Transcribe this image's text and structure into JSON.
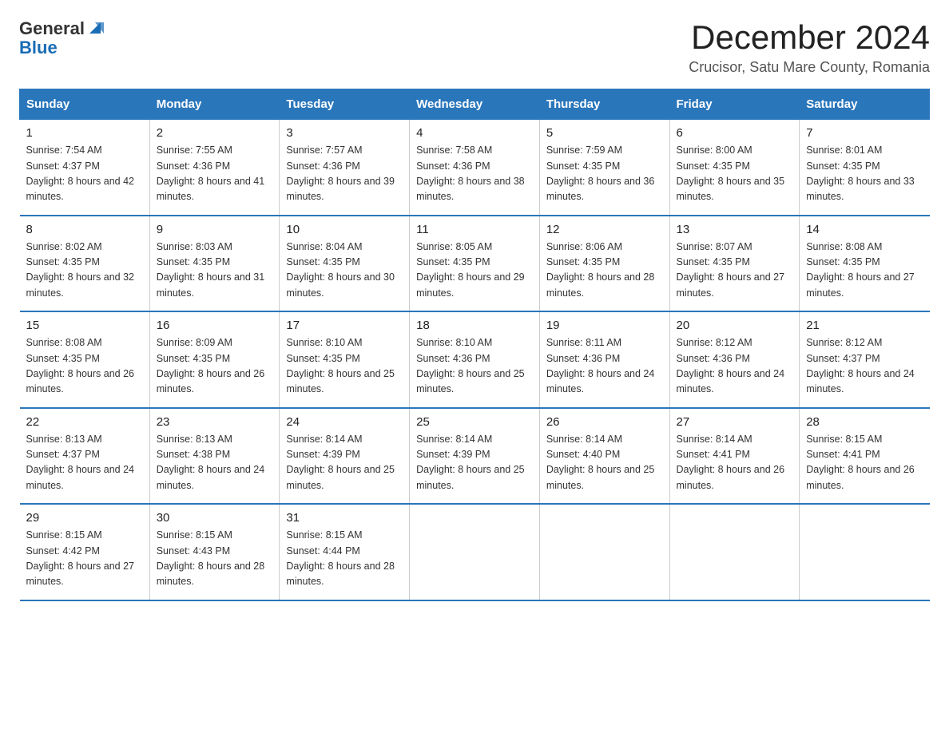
{
  "logo": {
    "general": "General",
    "blue": "Blue"
  },
  "title": "December 2024",
  "subtitle": "Crucisor, Satu Mare County, Romania",
  "headers": [
    "Sunday",
    "Monday",
    "Tuesday",
    "Wednesday",
    "Thursday",
    "Friday",
    "Saturday"
  ],
  "weeks": [
    [
      {
        "day": "1",
        "sunrise": "7:54 AM",
        "sunset": "4:37 PM",
        "daylight": "8 hours and 42 minutes."
      },
      {
        "day": "2",
        "sunrise": "7:55 AM",
        "sunset": "4:36 PM",
        "daylight": "8 hours and 41 minutes."
      },
      {
        "day": "3",
        "sunrise": "7:57 AM",
        "sunset": "4:36 PM",
        "daylight": "8 hours and 39 minutes."
      },
      {
        "day": "4",
        "sunrise": "7:58 AM",
        "sunset": "4:36 PM",
        "daylight": "8 hours and 38 minutes."
      },
      {
        "day": "5",
        "sunrise": "7:59 AM",
        "sunset": "4:35 PM",
        "daylight": "8 hours and 36 minutes."
      },
      {
        "day": "6",
        "sunrise": "8:00 AM",
        "sunset": "4:35 PM",
        "daylight": "8 hours and 35 minutes."
      },
      {
        "day": "7",
        "sunrise": "8:01 AM",
        "sunset": "4:35 PM",
        "daylight": "8 hours and 33 minutes."
      }
    ],
    [
      {
        "day": "8",
        "sunrise": "8:02 AM",
        "sunset": "4:35 PM",
        "daylight": "8 hours and 32 minutes."
      },
      {
        "day": "9",
        "sunrise": "8:03 AM",
        "sunset": "4:35 PM",
        "daylight": "8 hours and 31 minutes."
      },
      {
        "day": "10",
        "sunrise": "8:04 AM",
        "sunset": "4:35 PM",
        "daylight": "8 hours and 30 minutes."
      },
      {
        "day": "11",
        "sunrise": "8:05 AM",
        "sunset": "4:35 PM",
        "daylight": "8 hours and 29 minutes."
      },
      {
        "day": "12",
        "sunrise": "8:06 AM",
        "sunset": "4:35 PM",
        "daylight": "8 hours and 28 minutes."
      },
      {
        "day": "13",
        "sunrise": "8:07 AM",
        "sunset": "4:35 PM",
        "daylight": "8 hours and 27 minutes."
      },
      {
        "day": "14",
        "sunrise": "8:08 AM",
        "sunset": "4:35 PM",
        "daylight": "8 hours and 27 minutes."
      }
    ],
    [
      {
        "day": "15",
        "sunrise": "8:08 AM",
        "sunset": "4:35 PM",
        "daylight": "8 hours and 26 minutes."
      },
      {
        "day": "16",
        "sunrise": "8:09 AM",
        "sunset": "4:35 PM",
        "daylight": "8 hours and 26 minutes."
      },
      {
        "day": "17",
        "sunrise": "8:10 AM",
        "sunset": "4:35 PM",
        "daylight": "8 hours and 25 minutes."
      },
      {
        "day": "18",
        "sunrise": "8:10 AM",
        "sunset": "4:36 PM",
        "daylight": "8 hours and 25 minutes."
      },
      {
        "day": "19",
        "sunrise": "8:11 AM",
        "sunset": "4:36 PM",
        "daylight": "8 hours and 24 minutes."
      },
      {
        "day": "20",
        "sunrise": "8:12 AM",
        "sunset": "4:36 PM",
        "daylight": "8 hours and 24 minutes."
      },
      {
        "day": "21",
        "sunrise": "8:12 AM",
        "sunset": "4:37 PM",
        "daylight": "8 hours and 24 minutes."
      }
    ],
    [
      {
        "day": "22",
        "sunrise": "8:13 AM",
        "sunset": "4:37 PM",
        "daylight": "8 hours and 24 minutes."
      },
      {
        "day": "23",
        "sunrise": "8:13 AM",
        "sunset": "4:38 PM",
        "daylight": "8 hours and 24 minutes."
      },
      {
        "day": "24",
        "sunrise": "8:14 AM",
        "sunset": "4:39 PM",
        "daylight": "8 hours and 25 minutes."
      },
      {
        "day": "25",
        "sunrise": "8:14 AM",
        "sunset": "4:39 PM",
        "daylight": "8 hours and 25 minutes."
      },
      {
        "day": "26",
        "sunrise": "8:14 AM",
        "sunset": "4:40 PM",
        "daylight": "8 hours and 25 minutes."
      },
      {
        "day": "27",
        "sunrise": "8:14 AM",
        "sunset": "4:41 PM",
        "daylight": "8 hours and 26 minutes."
      },
      {
        "day": "28",
        "sunrise": "8:15 AM",
        "sunset": "4:41 PM",
        "daylight": "8 hours and 26 minutes."
      }
    ],
    [
      {
        "day": "29",
        "sunrise": "8:15 AM",
        "sunset": "4:42 PM",
        "daylight": "8 hours and 27 minutes."
      },
      {
        "day": "30",
        "sunrise": "8:15 AM",
        "sunset": "4:43 PM",
        "daylight": "8 hours and 28 minutes."
      },
      {
        "day": "31",
        "sunrise": "8:15 AM",
        "sunset": "4:44 PM",
        "daylight": "8 hours and 28 minutes."
      },
      null,
      null,
      null,
      null
    ]
  ]
}
